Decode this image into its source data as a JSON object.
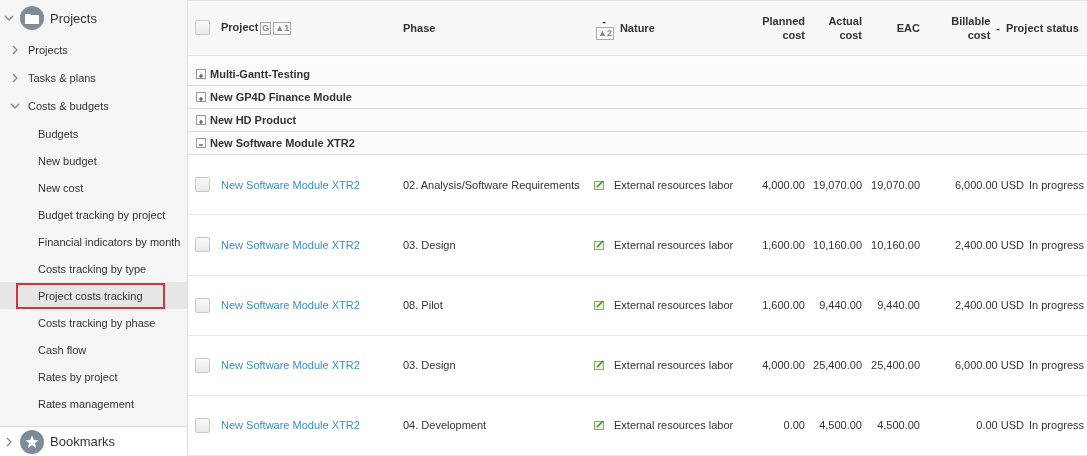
{
  "sidebar": {
    "section": {
      "label": "Projects",
      "expanded": true
    },
    "items": [
      {
        "label": "Projects",
        "expanded": false
      },
      {
        "label": "Tasks & plans",
        "expanded": false
      },
      {
        "label": "Costs & budgets",
        "expanded": true,
        "children": [
          {
            "label": "Budgets",
            "selected": false
          },
          {
            "label": "New budget",
            "selected": false
          },
          {
            "label": "New cost",
            "selected": false
          },
          {
            "label": "Budget tracking by project",
            "selected": false
          },
          {
            "label": "Financial indicators by month",
            "selected": false
          },
          {
            "label": "Costs tracking by type",
            "selected": false
          },
          {
            "label": "Project costs tracking",
            "selected": true
          },
          {
            "label": "Costs tracking by phase",
            "selected": false
          },
          {
            "label": "Cash flow",
            "selected": false
          },
          {
            "label": "Rates by project",
            "selected": false
          },
          {
            "label": "Rates management",
            "selected": false
          }
        ]
      }
    ],
    "bookmarks": {
      "label": "Bookmarks",
      "expanded": false
    }
  },
  "table": {
    "select_all": {
      "checked": false
    },
    "columns": [
      {
        "label": "Project",
        "badges": [
          "G",
          "▲1"
        ]
      },
      {
        "label": "Phase"
      },
      {
        "label": "Nature",
        "marker": "-",
        "badges": [
          "▲2"
        ]
      },
      {
        "label": "Planned cost"
      },
      {
        "label": "Actual cost"
      },
      {
        "label": "EAC"
      },
      {
        "label": "Billable cost",
        "marker": "-"
      },
      {
        "label": "Project status"
      }
    ],
    "groups": [
      {
        "label": "Multi-Gantt-Testing",
        "expanded": false
      },
      {
        "label": "New GP4D Finance Module",
        "expanded": false
      },
      {
        "label": "New HD Product",
        "expanded": false
      },
      {
        "label": "New Software Module XTR2",
        "expanded": true,
        "rows": [
          {
            "checked": false,
            "project": "New Software Module XTR2",
            "phase": "02. Analysis/Software Requirements",
            "nature": "External resources labor",
            "planned": "4,000.00",
            "actual": "19,070.00",
            "eac": "19,070.00",
            "billable": "6,000.00 USD",
            "status": "In progress"
          },
          {
            "checked": false,
            "project": "New Software Module XTR2",
            "phase": "03. Design",
            "nature": "External resources labor",
            "planned": "1,600.00",
            "actual": "10,160.00",
            "eac": "10,160.00",
            "billable": "2,400.00 USD",
            "status": "In progress"
          },
          {
            "checked": false,
            "project": "New Software Module XTR2",
            "phase": "08. Pilot",
            "nature": "External resources labor",
            "planned": "1,600.00",
            "actual": "9,440.00",
            "eac": "9,440.00",
            "billable": "2,400.00 USD",
            "status": "In progress"
          },
          {
            "checked": false,
            "project": "New Software Module XTR2",
            "phase": "03. Design",
            "nature": "External resources labor",
            "planned": "4,000.00",
            "actual": "25,400.00",
            "eac": "25,400.00",
            "billable": "6,000.00 USD",
            "status": "In progress"
          },
          {
            "checked": false,
            "project": "New Software Module XTR2",
            "phase": "04. Development",
            "nature": "External resources labor",
            "planned": "0.00",
            "actual": "4,500.00",
            "eac": "4,500.00",
            "billable": "0.00 USD",
            "status": "In progress"
          }
        ]
      }
    ]
  }
}
